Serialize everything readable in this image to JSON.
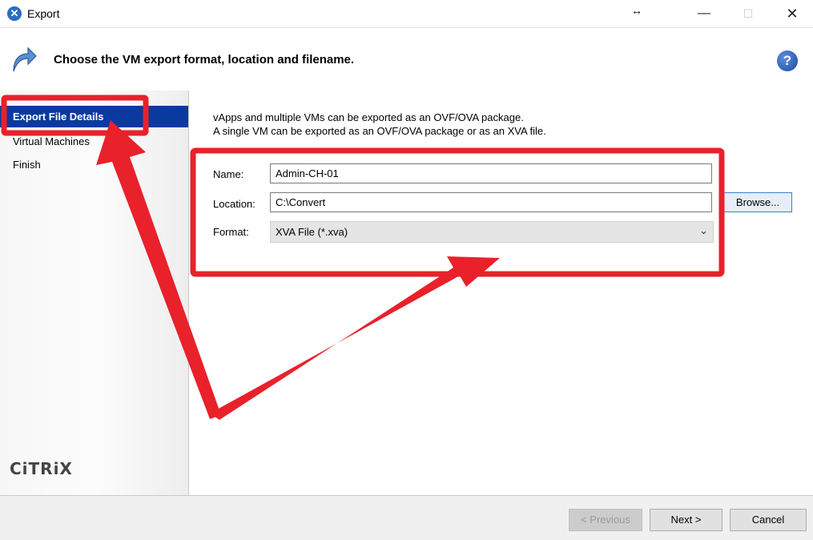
{
  "window": {
    "title": "Export",
    "resize_glyph": "↔",
    "controls": {
      "minimize": "—",
      "maximize": "☐",
      "close": "✕"
    }
  },
  "header": {
    "title": "Choose the VM export format, location and filename.",
    "help": "?"
  },
  "sidebar": {
    "items": [
      {
        "label": "Export File Details",
        "active": true
      },
      {
        "label": "Virtual Machines",
        "active": false
      },
      {
        "label": "Finish",
        "active": false
      }
    ],
    "logo": "CiTRiX"
  },
  "main": {
    "info_line1": "vApps and multiple VMs can be exported as an OVF/OVA package.",
    "info_line2": "A single VM can be exported as an OVF/OVA package or as an XVA file.",
    "name_label": "Name:",
    "name_value": "Admin-CH-01",
    "location_label": "Location:",
    "location_value": "C:\\Convert",
    "browse_label": "Browse...",
    "format_label": "Format:",
    "format_value": "XVA File (*.xva)"
  },
  "footer": {
    "previous_label": "< Previous",
    "next_label": "Next >",
    "cancel_label": "Cancel"
  },
  "colors": {
    "selection": "#0a3aa0",
    "annotation_red": "#e8212b"
  }
}
